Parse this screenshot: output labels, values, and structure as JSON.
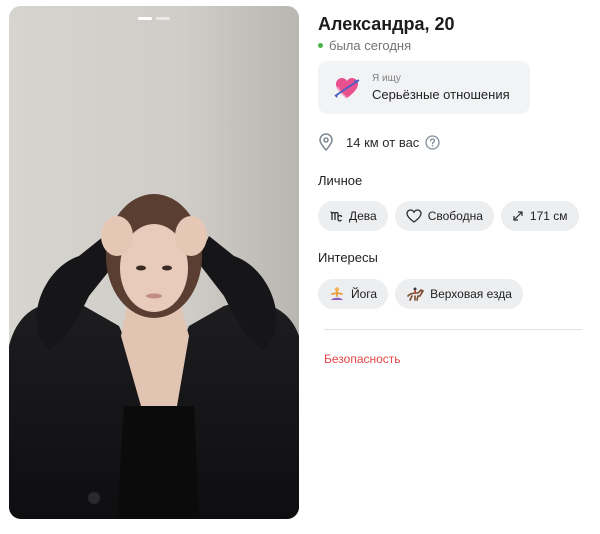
{
  "profile": {
    "name_age": "Александра, 20",
    "status": "была сегодня",
    "photo": {
      "description_icon": "profile-photo",
      "slides_total": 2,
      "active_slide": 1
    }
  },
  "goal": {
    "small_label": "Я ищу",
    "value": "Серьёзные отношения",
    "icon": "heart-arrow-icon"
  },
  "distance": {
    "text": "14 км от вас",
    "icon": "pin-icon",
    "help_icon": "question-icon"
  },
  "personal": {
    "title": "Личное",
    "chips": [
      {
        "icon": "virgo-icon",
        "label": "Дева"
      },
      {
        "icon": "heart-outline-icon",
        "label": "Свободна"
      },
      {
        "icon": "resize-icon",
        "label": "171 см"
      }
    ]
  },
  "interests": {
    "title": "Интересы",
    "chips": [
      {
        "icon": "yoga-icon",
        "label": "Йога"
      },
      {
        "icon": "horse-riding-icon",
        "label": "Верховая езда"
      }
    ]
  },
  "safety": {
    "label": "Безопасность"
  },
  "colors": {
    "online": "#4bb34b",
    "danger": "#e64646",
    "chip_bg": "#edeef0",
    "card_bg": "#f2f3f5"
  }
}
